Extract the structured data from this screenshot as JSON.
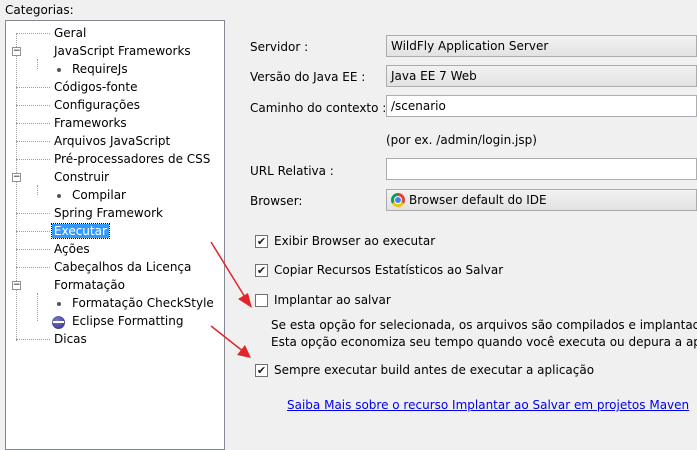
{
  "categories_label": "Categorias:",
  "tree": {
    "items": [
      {
        "label": "Geral"
      },
      {
        "label": "JavaScript Frameworks",
        "expanded": true
      },
      {
        "label": "RequireJs"
      },
      {
        "label": "Códigos-fonte"
      },
      {
        "label": "Configurações"
      },
      {
        "label": "Frameworks"
      },
      {
        "label": "Arquivos JavaScript"
      },
      {
        "label": "Pré-processadores de CSS"
      },
      {
        "label": "Construir",
        "expanded": true
      },
      {
        "label": "Compilar"
      },
      {
        "label": "Spring Framework"
      },
      {
        "label": "Executar",
        "selected": true
      },
      {
        "label": "Ações"
      },
      {
        "label": "Cabeçalhos da Licença"
      },
      {
        "label": "Formatação",
        "expanded": true
      },
      {
        "label": "Formatação CheckStyle"
      },
      {
        "label": "Eclipse Formatting",
        "icon": "eclipse-icon"
      },
      {
        "label": "Dicas"
      }
    ]
  },
  "form": {
    "server_label": "Servidor :",
    "server_value": "WildFly Application Server",
    "javaee_label": "Versão do Java EE :",
    "javaee_value": "Java EE 7 Web",
    "context_label": "Caminho do contexto :",
    "context_value": "/scenario",
    "context_hint": "(por ex. /admin/login.jsp)",
    "url_label": "URL Relativa :",
    "url_value": "",
    "browser_label": "Browser:",
    "browser_value": "Browser default do IDE",
    "browser_icon": "chrome-icon"
  },
  "options": {
    "show_browser": {
      "label": "Exibir Browser ao executar",
      "checked": true
    },
    "copy_static": {
      "label": "Copiar Recursos Estatísticos ao Salvar",
      "checked": true
    },
    "deploy_on_save": {
      "label": "Implantar ao salvar",
      "checked": false
    },
    "deploy_desc_1": "Se esta opção for selecionada, os arquivos são compilados e implantados",
    "deploy_desc_2": "Esta opção economiza seu tempo quando você executa ou depura a aplica",
    "always_build": {
      "label": "Sempre executar build antes de executar a aplicação",
      "checked": true
    }
  },
  "learn_more_link": "Saiba Mais sobre o recurso Implantar ao Salvar em projetos Maven",
  "colors": {
    "selection": "#3399ff",
    "annotation_arrow": "#e0262a",
    "link": "#0000ee"
  }
}
